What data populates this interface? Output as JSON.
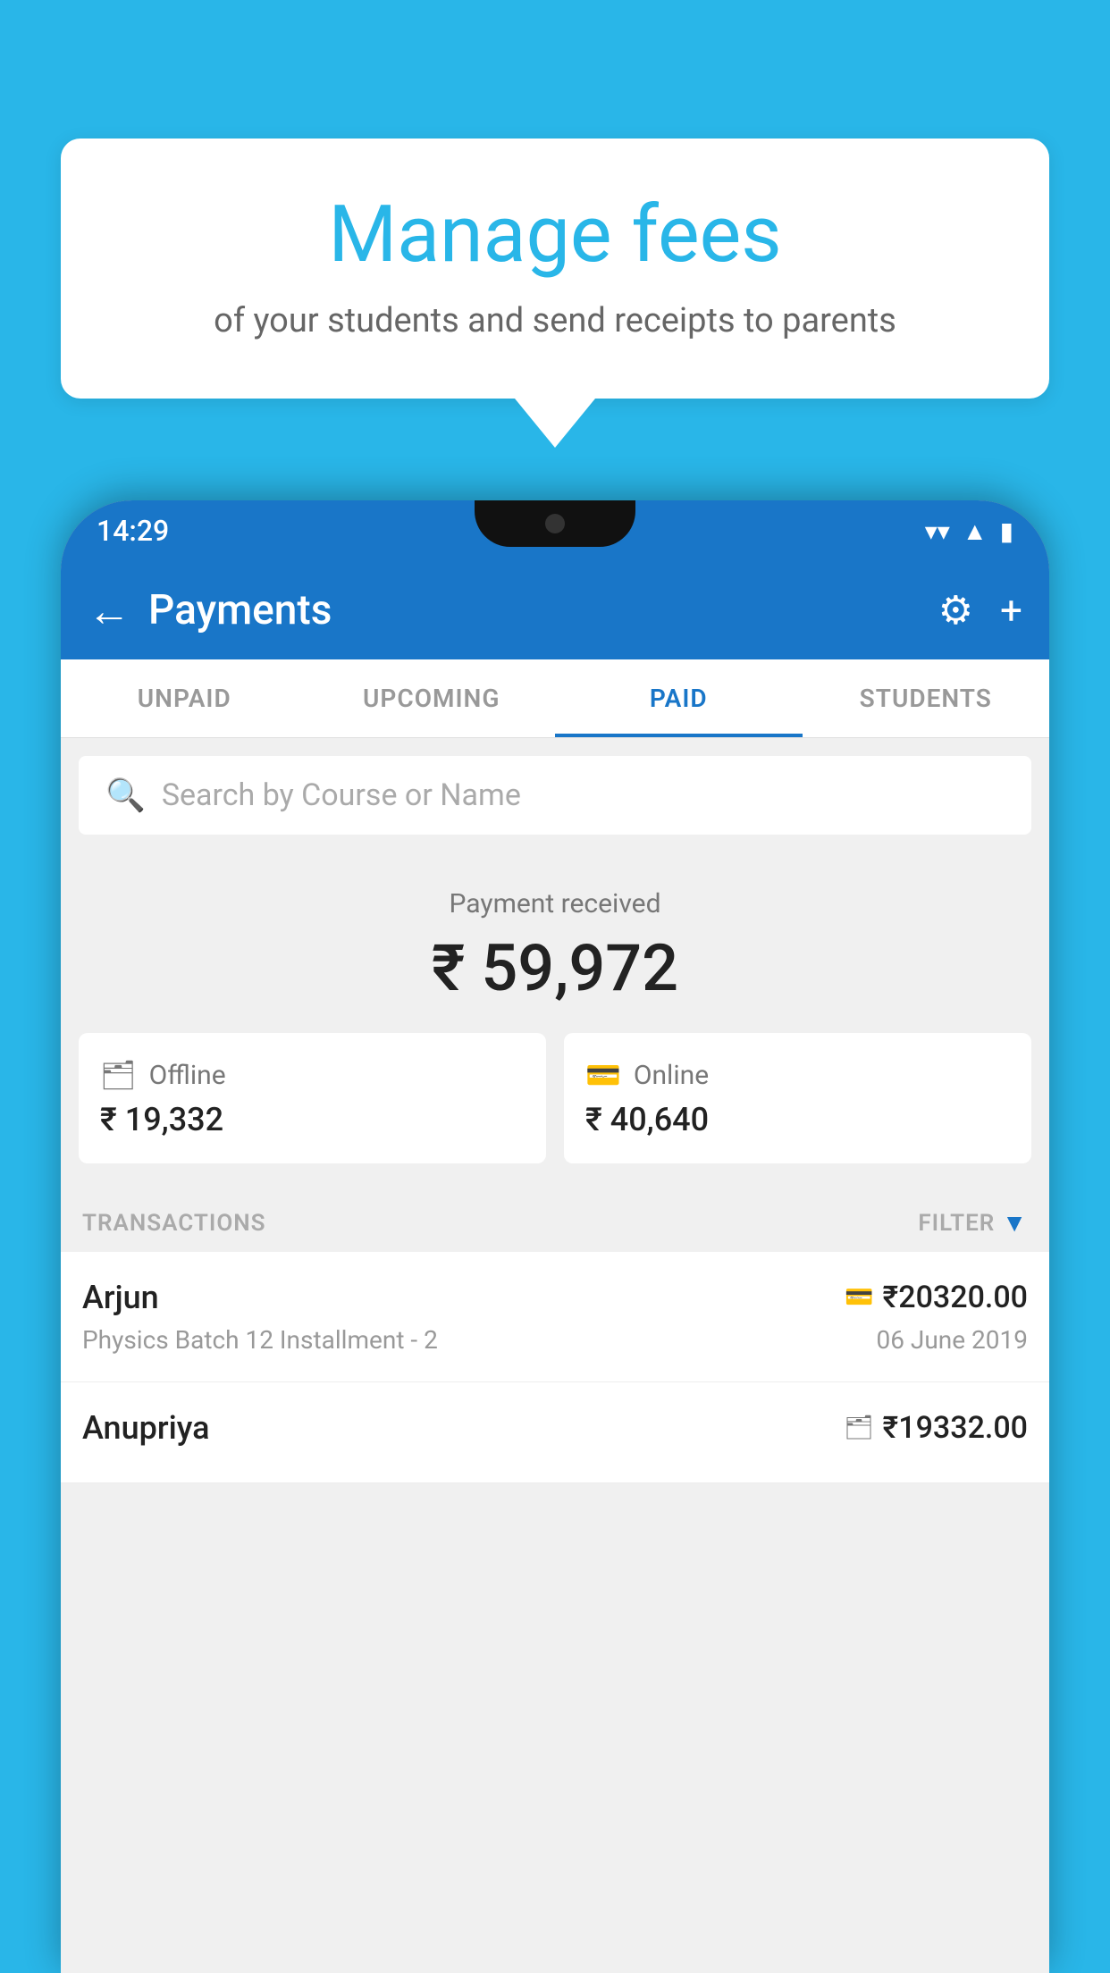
{
  "background_color": "#29b6e8",
  "bubble": {
    "title": "Manage fees",
    "subtitle": "of your students and send receipts to parents"
  },
  "status_bar": {
    "time": "14:29",
    "icons": [
      "wifi",
      "signal",
      "battery"
    ]
  },
  "app_bar": {
    "title": "Payments",
    "back_icon": "←",
    "settings_icon": "⚙",
    "add_icon": "+"
  },
  "tabs": [
    {
      "label": "UNPAID",
      "active": false
    },
    {
      "label": "UPCOMING",
      "active": false
    },
    {
      "label": "PAID",
      "active": true
    },
    {
      "label": "STUDENTS",
      "active": false
    }
  ],
  "search": {
    "placeholder": "Search by Course or Name"
  },
  "payment_summary": {
    "label": "Payment received",
    "amount": "₹ 59,972",
    "offline_label": "Offline",
    "offline_amount": "₹ 19,332",
    "online_label": "Online",
    "online_amount": "₹ 40,640"
  },
  "transactions": {
    "label": "TRANSACTIONS",
    "filter_label": "FILTER",
    "rows": [
      {
        "name": "Arjun",
        "detail": "Physics Batch 12 Installment - 2",
        "amount": "₹20320.00",
        "date": "06 June 2019",
        "type": "online"
      },
      {
        "name": "Anupriya",
        "detail": "",
        "amount": "₹19332.00",
        "date": "",
        "type": "offline"
      }
    ]
  }
}
